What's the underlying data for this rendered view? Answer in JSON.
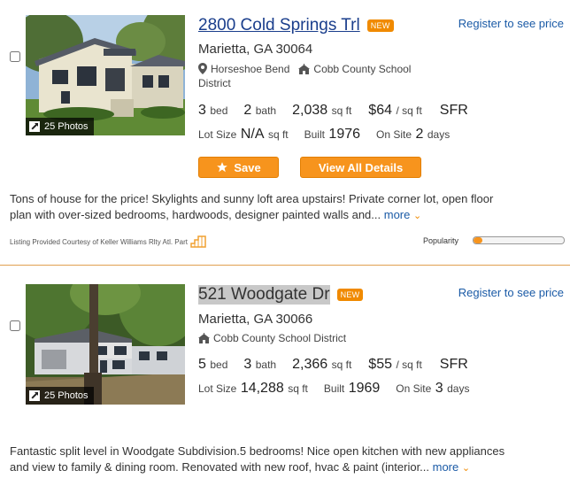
{
  "listings": [
    {
      "address": "2800 Cold Springs Trl",
      "badge": "NEW",
      "register": "Register to see price",
      "city": "Marietta, GA 30064",
      "subdivision": "Horseshoe Bend",
      "school": "Cobb County School",
      "school_cont": "District",
      "photos": "25 Photos",
      "beds": "3",
      "beds_label": "bed",
      "baths": "2",
      "baths_label": "bath",
      "sqft": "2,038",
      "sqft_label": "sq ft",
      "price_sqft": "$64",
      "price_sqft_label": "/ sq ft",
      "type": "SFR",
      "lot_label": "Lot Size",
      "lot": "N/A",
      "lot_unit": "sq ft",
      "built_label": "Built",
      "built": "1976",
      "onsite_label": "On Site",
      "onsite": "2",
      "onsite_unit": "days",
      "save": "Save",
      "details": "View All Details",
      "desc1": "Tons of house for the price! Skylights and sunny loft area upstairs! Private corner lot, open floor",
      "desc2": "plan with over-sized bedrooms, hardwoods, designer painted walls and... ",
      "more": "more",
      "courtesy": "Listing Provided Courtesy of Keller Williams Rlty Atl. Part",
      "popularity_label": "Popularity",
      "popularity": 0.1
    },
    {
      "address": "521 Woodgate Dr",
      "badge": "NEW",
      "register": "Register to see price",
      "city": "Marietta, GA 30066",
      "school": "Cobb County School District",
      "photos": "25 Photos",
      "beds": "5",
      "beds_label": "bed",
      "baths": "3",
      "baths_label": "bath",
      "sqft": "2,366",
      "sqft_label": "sq ft",
      "price_sqft": "$55",
      "price_sqft_label": "/ sq ft",
      "type": "SFR",
      "lot_label": "Lot Size",
      "lot": "14,288",
      "lot_unit": "sq ft",
      "built_label": "Built",
      "built": "1969",
      "onsite_label": "On Site",
      "onsite": "3",
      "onsite_unit": "days",
      "desc1": "Fantastic split level in Woodgate Subdivision.5 bedrooms! Nice open kitchen with new appliances",
      "desc2": "and view to family & dining room. Renovated with new roof, hvac & paint (interior... ",
      "more": "more"
    }
  ],
  "colors": {
    "accent": "#f7941d",
    "link": "#1a3e8c",
    "badge": "#f08a00"
  },
  "icons": [
    "map-pin-icon",
    "school-icon",
    "expand-icon",
    "star-icon",
    "chevron-down-icon",
    "broker-logo-icon"
  ]
}
